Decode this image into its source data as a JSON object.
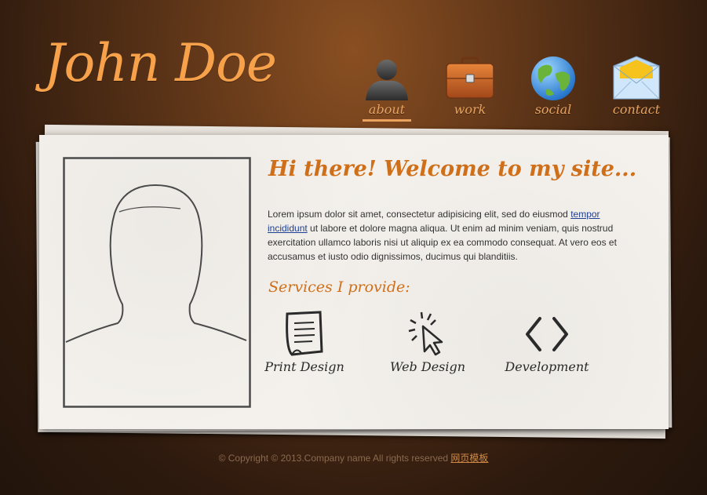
{
  "header": {
    "logo": "John Doe"
  },
  "nav": {
    "items": [
      {
        "label": "about",
        "icon": "person-icon",
        "active": true
      },
      {
        "label": "work",
        "icon": "briefcase-icon",
        "active": false
      },
      {
        "label": "social",
        "icon": "globe-icon",
        "active": false
      },
      {
        "label": "contact",
        "icon": "envelope-icon",
        "active": false
      }
    ]
  },
  "main": {
    "welcome": "Hi there! Welcome to my site...",
    "intro": {
      "part1": "Lorem ipsum dolor sit amet, consectetur adipisicing elit, sed do eiusmod ",
      "link": "tempor incididunt",
      "part2": " ut labore et dolore magna aliqua. Ut enim ad minim veniam, quis nostrud exercitation ullamco laboris nisi ut aliquip ex ea commodo consequat. At vero eos et accusamus et iusto odio dignissimos, ducimus qui blanditiis."
    },
    "services_title": "Services I provide:",
    "services": [
      {
        "label": "Print Design",
        "icon": "document-icon"
      },
      {
        "label": "Web Design",
        "icon": "cursor-click-icon"
      },
      {
        "label": "Development",
        "icon": "code-brackets-icon"
      }
    ]
  },
  "footer": {
    "copyright": "© Copyright © 2013.Company name All rights reserved ",
    "link": "网页模板"
  },
  "colors": {
    "accent": "#cf6f1a",
    "logo": "#f7a24b",
    "nav_label": "#e9a35f",
    "link": "#1f3f93"
  }
}
